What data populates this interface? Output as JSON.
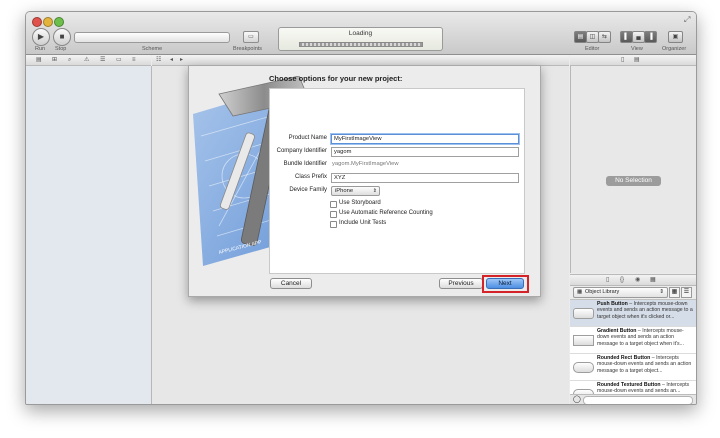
{
  "toolbar": {
    "run_label": "Run",
    "stop_label": "Stop",
    "scheme_label": "Scheme",
    "breakpoints_label": "Breakpoints",
    "activity_status": "Loading",
    "editor_label": "Editor",
    "view_label": "View",
    "organizer_label": "Organizer"
  },
  "inspector": {
    "no_selection": "No Selection"
  },
  "library": {
    "selector_value": "Object Library",
    "items": [
      {
        "name": "Push Button",
        "desc": " – Intercepts mouse-down events and sends an action message to a target object when it's clicked or..."
      },
      {
        "name": "Gradient Button",
        "desc": " – Intercepts mouse-down events and sends an action message to a target object when it's..."
      },
      {
        "name": "Rounded Rect Button",
        "desc": " – Intercepts mouse-down events and sends an action message to a target object..."
      },
      {
        "name": "Rounded Textured Button",
        "desc": " – Intercepts mouse-down events and sends an..."
      }
    ]
  },
  "sheet": {
    "title": "Choose options for your new project:",
    "fields": {
      "product_name_label": "Product Name",
      "product_name_value": "MyFirstImageView",
      "company_identifier_label": "Company Identifier",
      "company_identifier_value": "yagom",
      "bundle_identifier_label": "Bundle Identifier",
      "bundle_identifier_value": "yagom.MyFirstImageView",
      "class_prefix_label": "Class Prefix",
      "class_prefix_value": "XYZ",
      "device_family_label": "Device Family",
      "device_family_value": "iPhone"
    },
    "checkboxes": {
      "storyboard": "Use Storyboard",
      "arc": "Use Automatic Reference Counting",
      "unit_tests": "Include Unit Tests"
    },
    "buttons": {
      "cancel": "Cancel",
      "previous": "Previous",
      "next": "Next"
    }
  },
  "colors": {
    "highlight": "#d4242a",
    "default_button": "#4e8fe3",
    "focus_ring": "#5b8fd8"
  }
}
